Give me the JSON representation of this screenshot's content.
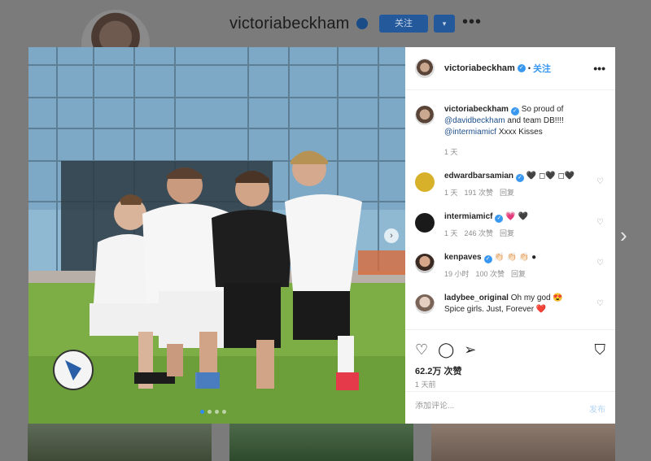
{
  "background_profile": {
    "username": "victoriabeckham",
    "follow_label": "关注",
    "dropdown_icon": "▾",
    "more_icon": "•••"
  },
  "next_post_icon": "›",
  "post": {
    "author": "victoriabeckham",
    "follow_label": "关注",
    "separator": "•",
    "more_icon": "•••",
    "photo_nav_icon": "›",
    "carousel": {
      "count": 4,
      "active": 0
    },
    "caption": {
      "user": "victoriabeckham",
      "text_1": "So proud of",
      "mention_1": "@davidbeckham",
      "text_2": "and team DB!!!!",
      "mention_2": "@intermiamicf",
      "text_3": "Xxxx Kisses",
      "time": "1 天"
    },
    "comments": [
      {
        "user": "edwardbarsamian",
        "verified": true,
        "text": "🖤 ◻🖤 ◻🖤",
        "time": "1 天",
        "likes": "191 次赞",
        "reply": "回复"
      },
      {
        "user": "intermiamicf",
        "verified": true,
        "text": "💗 🖤",
        "time": "1 天",
        "likes": "246 次赞",
        "reply": "回复"
      },
      {
        "user": "kenpaves",
        "verified": true,
        "text": "👏🏻 👏🏻 👏🏻 ●",
        "time": "19 小时",
        "likes": "100 次赞",
        "reply": "回复"
      },
      {
        "user": "ladybee_original",
        "verified": false,
        "text": "Oh my god 😍",
        "text_2": "Spice girls. Just, Forever ❤️"
      }
    ],
    "like_count": "62.2万 次赞",
    "posted_ago": "1 天前",
    "comment_placeholder": "添加评论...",
    "publish_label": "发布"
  },
  "colors": {
    "accent": "#3897f0",
    "link": "#1e4f8a",
    "muted": "#8e8e8e"
  }
}
